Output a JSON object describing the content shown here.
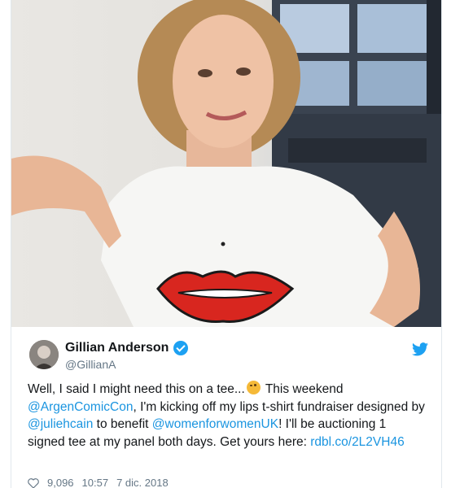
{
  "photo": {
    "icon": "photo"
  },
  "tweet": {
    "author_name": "Gillian Anderson",
    "handle": "@GillianA",
    "verified_icon": "verified-badge-icon",
    "bird_icon": "twitter-bird-icon",
    "text": {
      "part1": "Well, I said I might need this on a tee...",
      "emoji": "winking-face-icon",
      "part2": " This weekend ",
      "mention1": "@ArgenComicCon",
      "part3": ", I'm kicking off my lips t-shirt fundraiser designed by ",
      "mention2": "@juliehcain",
      "part4": " to benefit ",
      "mention3": "@womenforwomenUK",
      "part5": "! I'll be auctioning 1 signed tee at my panel both days. Get yours here: ",
      "link": "rdbl.co/2L2VH46"
    },
    "meta": {
      "likes": "9,096",
      "time": "10:57",
      "date": "7 dic. 2018"
    }
  },
  "colors": {
    "link": "#1b95e0",
    "verified": "#1da1f2"
  }
}
